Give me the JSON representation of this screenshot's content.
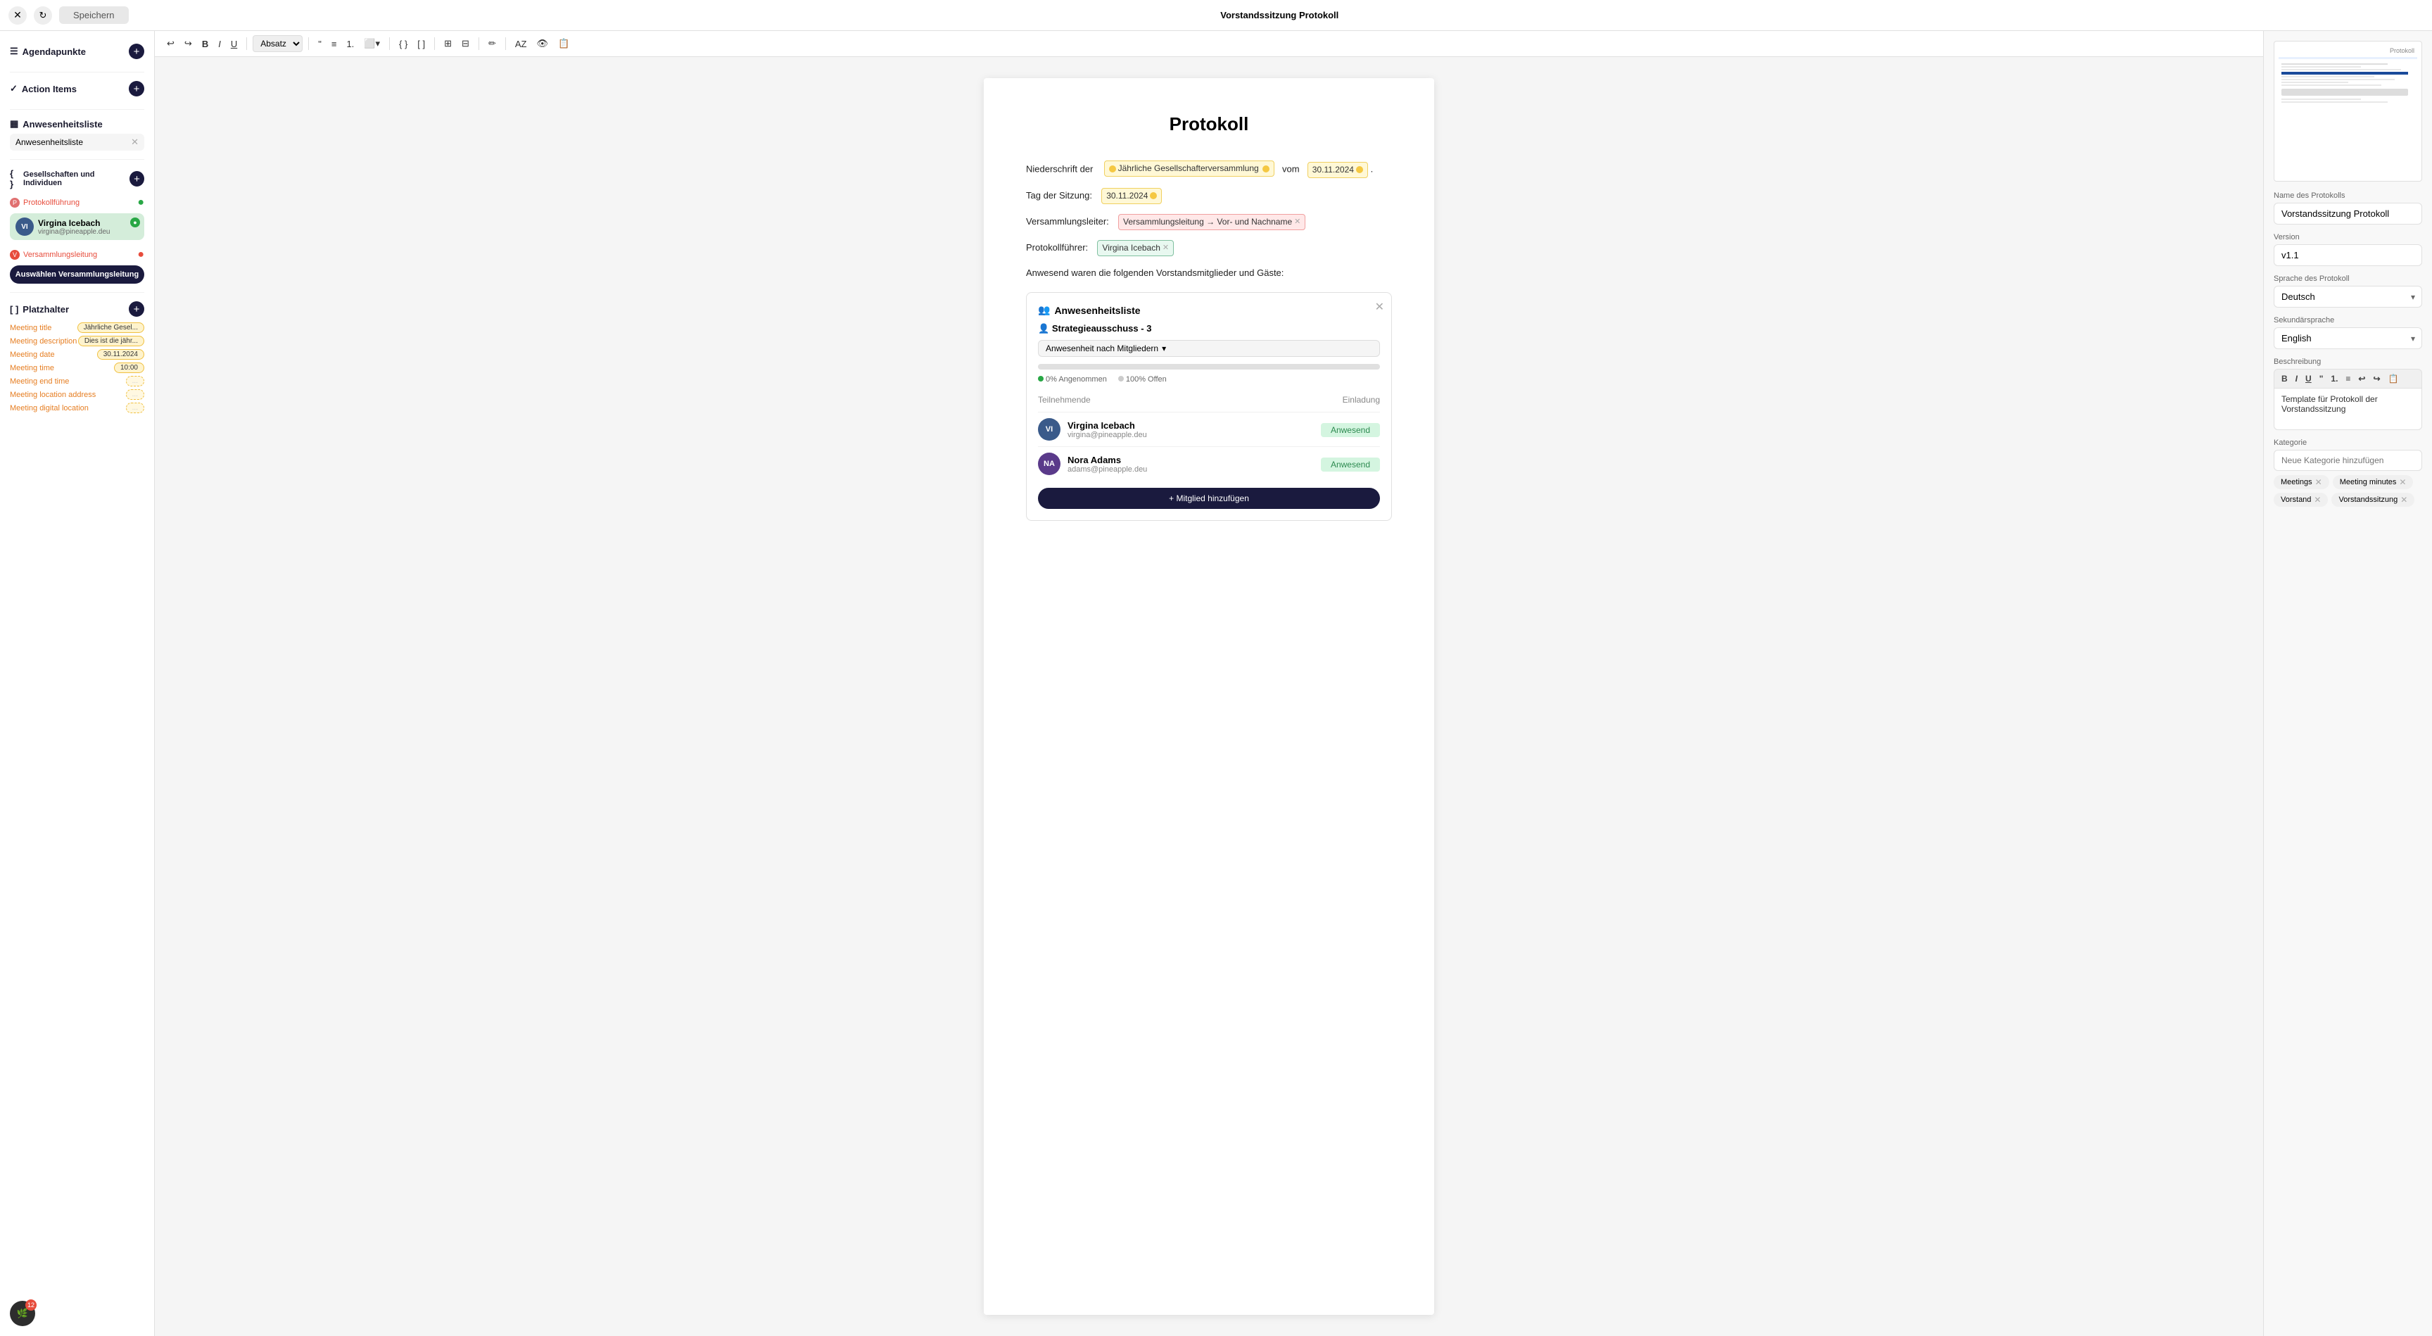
{
  "topbar": {
    "title": "Vorstandssitzung Protokoll",
    "save_label": "Speichern"
  },
  "toolbar": {
    "paragraph_label": "Absatz"
  },
  "document": {
    "title": "Protokoll",
    "line1_prefix": "Niederschrift der",
    "line1_tag": "Jährliche Gesellschafterversammlung",
    "line1_mid": "vom",
    "line1_date": "30.11.2024",
    "line2_prefix": "Tag der Sitzung:",
    "line2_date": "30.11.2024",
    "line3_prefix": "Versammlungsleiter:",
    "line3_tag": "Versammlungsleitung → Vor- und Nachname",
    "line4_prefix": "Protokollführer:",
    "line4_tag": "Virgina Icebach",
    "line5": "Anwesend waren die folgenden Vorstandsmitglieder und Gäste:",
    "attendance": {
      "title": "Anwesenheitsliste",
      "group_name": "Strategieausschuss",
      "group_count": "3",
      "dropdown_label": "Anwesenheit nach Mitgliedern",
      "progress_pct": 0,
      "stat1": "0% Angenommen",
      "stat2": "100% Offen",
      "col1": "Teilnehmende",
      "col2": "Einladung",
      "members": [
        {
          "initials": "VI",
          "name": "Virgina Icebach",
          "email": "virgina@pineapple.deu",
          "status": "Anwesend"
        },
        {
          "initials": "NA",
          "name": "Nora Adams",
          "email": "adams@pineapple.deu",
          "status": "Anwesend"
        }
      ]
    }
  },
  "sidebar": {
    "agenda_label": "Agendapunkte",
    "action_label": "Action Items",
    "attendance_label": "Anwesenheitsliste",
    "attendance_tag": "Anwesenheitsliste",
    "societies_label": "Gesellschaften und Individuen",
    "role1": "Protokollführung",
    "person_name": "Virgina Icebach",
    "person_email": "virgina@pineapple.deu",
    "role2": "Versammlungsleitung",
    "select_btn": "Auswählen Versammlungsleitung",
    "placeholder_label": "Platzhalter",
    "placeholders": [
      {
        "label": "Meeting title",
        "value": "Jährliche Gesel..."
      },
      {
        "label": "Meeting description",
        "value": "Dies ist die jähr..."
      },
      {
        "label": "Meeting date",
        "value": "30.11.2024"
      },
      {
        "label": "Meeting time",
        "value": "10:00"
      },
      {
        "label": "Meeting end time",
        "value": "..."
      },
      {
        "label": "Meeting location address",
        "value": "..."
      },
      {
        "label": "Meeting digital location",
        "value": "..."
      }
    ],
    "notif_count": "12"
  },
  "right_panel": {
    "name_label": "Name des Protokolls",
    "name_value": "Vorstandssitzung Protokoll",
    "version_label": "Version",
    "version_value": "v1.1",
    "language_label": "Sprache des Protokoll",
    "language_value": "Deutsch",
    "secondary_lang_label": "Sekundärsprache",
    "secondary_lang_value": "English",
    "desc_label": "Beschreibung",
    "desc_value": "Template für Protokoll der Vorstandssitzung",
    "category_label": "Kategorie",
    "category_placeholder": "Neue Kategorie hinzufügen",
    "tags": [
      "Meetings",
      "Meeting minutes",
      "Vorstand",
      "Vorstandssitzung"
    ]
  }
}
